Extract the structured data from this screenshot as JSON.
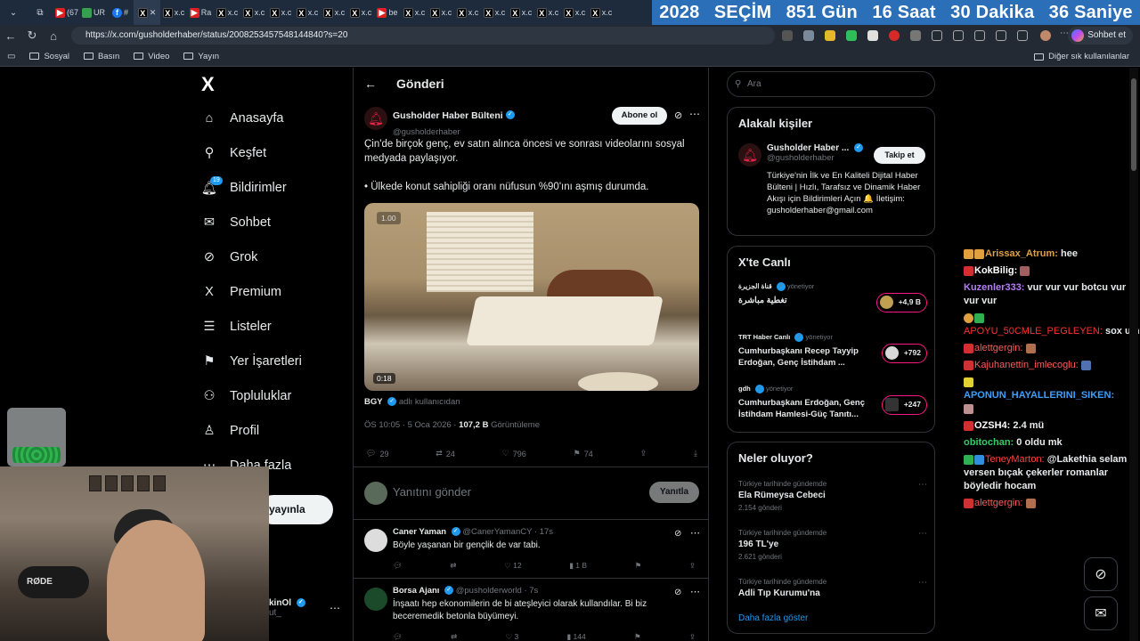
{
  "browser": {
    "tab_labels": [
      "(67",
      "UR",
      "#",
      "x.c",
      "x.c",
      "Ra",
      "x.c",
      "x.c",
      "x.c",
      "x.c",
      "x.c",
      "x.c",
      "be",
      "x.c",
      "x.c",
      "x.c",
      "x.c",
      "x.c",
      "x.c",
      "x.c",
      "x.c"
    ],
    "url": "https://x.com/gusholderhaber/status/2008253457548144840?s=20",
    "chat_button": "Sohbet et",
    "bookmarks": [
      "Sosyal",
      "Basın",
      "Video",
      "Yayın"
    ],
    "other_bookmarks": "Diğer sık kullanılanlar"
  },
  "countdown": {
    "year": "2028",
    "label": "SEÇİM",
    "days": "851 Gün",
    "hours": "16 Saat",
    "minutes": "30 Dakika",
    "seconds": "36 Saniye"
  },
  "nav": {
    "logo": "X",
    "items": [
      "Anasayfa",
      "Keşfet",
      "Bildirimler",
      "Sohbet",
      "Grok",
      "Premium",
      "Listeler",
      "Yer İşaretleri",
      "Topluluklar",
      "Profil",
      "Daha fazla"
    ],
    "notif_badge": "19",
    "post_button": "yayınla",
    "account_name": "kinOl",
    "account_handle": "ut_"
  },
  "post": {
    "header_title": "Gönderi",
    "author_name": "Gusholder Haber Bülteni",
    "author_handle": "@gusholderhaber",
    "follow_button": "Abone ol",
    "text_line1": "Çin'de birçok genç, ev satın alınca öncesi ve sonrası videolarını sosyal medyada paylaşıyor.",
    "text_line2": "• Ülkede konut sahipliği oranı nüfusun %90'ını aşmış durumda.",
    "video_zoom": "1.00",
    "video_duration": "0:18",
    "source_user": "BGY",
    "source_suffix": "adlı kullanıcıdan",
    "timestamp": "ÖS 10:05 · 5 Oca 2026 ·",
    "views_count": "107,2 B",
    "views_label": "Görüntüleme",
    "replies": "29",
    "reposts": "24",
    "likes": "796",
    "bookmarks": "74",
    "reply_placeholder": "Yanıtını gönder",
    "reply_button": "Yanıtla"
  },
  "replies": [
    {
      "name": "Caner Yaman",
      "handle": "@CanerYamanCY · 17s",
      "text": "Böyle yaşanan bir gençlik de var tabi.",
      "likes": "12",
      "views": "1 B",
      "replies": "",
      "reposts": ""
    },
    {
      "name": "Borsa Ajanı",
      "handle": "@pusholderworld · 7s",
      "text": "İnşaatı hep ekonomilerin de bi ateşleyici olarak kullandılar. Bi biz beceremedik betonla büyümeyi.",
      "likes": "3",
      "views": "144",
      "replies": "",
      "reposts": ""
    }
  ],
  "sidebar": {
    "search_placeholder": "Ara",
    "related_title": "Alakalı kişiler",
    "related_name": "Gusholder Haber ...",
    "related_handle": "@gusholderhaber",
    "related_follow": "Takip et",
    "related_bio": "Türkiye'nin İlk ve En Kaliteli Dijital Haber Bülteni | Hızlı, Tarafsız ve Dinamik Haber Akışı için Bildirimleri Açın 🔔 İletişim: gusholderhaber@gmail.com",
    "live_title": "X'te Canlı",
    "live_items": [
      {
        "host": "قناة الجزيرة",
        "role": "yönetiyor",
        "title": "تغطية مباشرة",
        "count": "+4,9 B"
      },
      {
        "host": "TRT Haber Canlı",
        "role": "yönetiyor",
        "title": "Cumhurbaşkanı Recep Tayyip Erdoğan, Genç İstihdam ...",
        "count": "+792"
      },
      {
        "host": "gdh",
        "role": "yönetiyor",
        "title": "Cumhurbaşkanı Erdoğan, Genç İstihdam Hamlesi-Güç Tanıtı...",
        "count": "+247"
      }
    ],
    "trends_title": "Neler oluyor?",
    "trends": [
      {
        "context": "Türkiye tarihinde gündemde",
        "title": "Ela Rümeysa Cebeci",
        "count": "2.154 gönderi"
      },
      {
        "context": "Türkiye tarihinde gündemde",
        "title": "196 TL'ye",
        "count": "2.621 gönderi"
      },
      {
        "context": "Türkiye tarihinde gündemde",
        "title": "Adli Tıp Kurumu'na",
        "count": ""
      }
    ],
    "show_more": "Daha fazla göster"
  },
  "chat": [
    {
      "user": "Arissax_Atrum:",
      "color": "#e0a040",
      "text": "hee"
    },
    {
      "user": "KokBilig:",
      "color": "#ffffff",
      "text": ""
    },
    {
      "user": "Kuzenler333:",
      "color": "#b57bff",
      "text": "vur vur vur botcu vur vur vur"
    },
    {
      "user": "APOYU_50CMLE_PEGLEYEN:",
      "color": "#ff3030",
      "text": "sox um"
    },
    {
      "user": "alettgergin:",
      "color": "#ff5a5a",
      "text": ""
    },
    {
      "user": "Kajuhanettin_imlecoglu:",
      "color": "#ff5a5a",
      "text": ""
    },
    {
      "user": "APONUN_HAYALLERINI_SIKEN:",
      "color": "#3aa0ff",
      "text": ""
    },
    {
      "user": "OZSH4:",
      "color": "#ffffff",
      "text": "2.4 mü"
    },
    {
      "user": "obitochan:",
      "color": "#33cc66",
      "text": "0 oldu mk"
    },
    {
      "user": "TeneyMarton:",
      "color": "#ff4040",
      "text": "@Lakethia selam versen bıçak çekerler romanlar böyledir hocam"
    },
    {
      "user": "alettgergin:",
      "color": "#ff5a5a",
      "text": ""
    }
  ],
  "webcam": {
    "mic_label": "RØDE"
  }
}
